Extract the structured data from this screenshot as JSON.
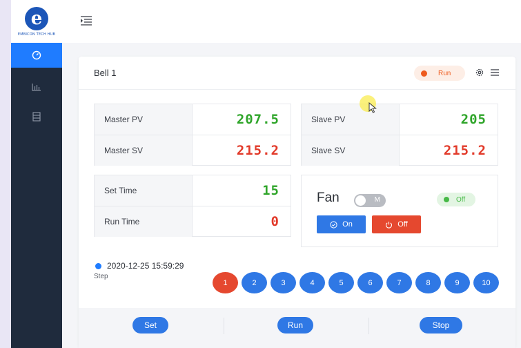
{
  "logo": {
    "text": "EMBICON TECH HUB"
  },
  "sidebar": {
    "items": [
      "dashboard-icon",
      "chart-icon",
      "list-icon"
    ]
  },
  "card": {
    "title": "Bell 1",
    "status_badge": "Run",
    "metrics_left": [
      {
        "label": "Master PV",
        "value": "207.5"
      },
      {
        "label": "Master SV",
        "value": "215.2"
      }
    ],
    "metrics_right": [
      {
        "label": "Slave PV",
        "value": "205"
      },
      {
        "label": "Slave SV",
        "value": "215.2"
      }
    ],
    "time": [
      {
        "label": "Set Time",
        "value": "15"
      },
      {
        "label": "Run Time",
        "value": "0"
      }
    ]
  },
  "fan": {
    "label": "Fan",
    "mode": "M",
    "status": "Off",
    "on_label": "On",
    "off_label": "Off"
  },
  "timestamp": "2020-12-25 15:59:29",
  "step_label": "Step",
  "steps": [
    "1",
    "2",
    "3",
    "4",
    "5",
    "6",
    "7",
    "8",
    "9",
    "10"
  ],
  "active_step": "1",
  "footer": {
    "set": "Set",
    "run": "Run",
    "stop": "Stop"
  },
  "colors": {
    "accent": "#1f7cff",
    "pv": "#2fa52a",
    "sv": "#e23a2a",
    "run": "#ee5b1e"
  }
}
